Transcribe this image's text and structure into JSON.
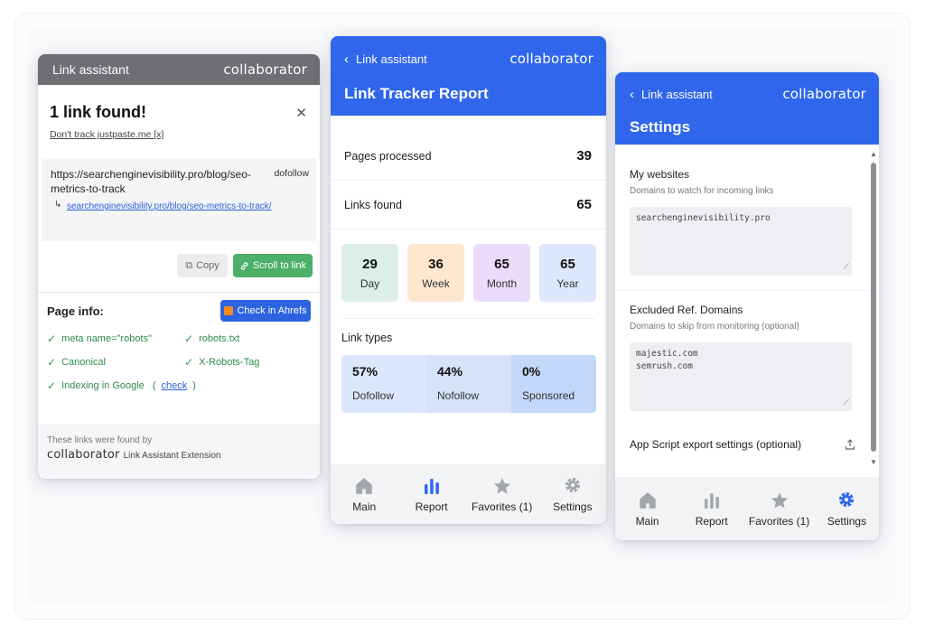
{
  "panel1": {
    "header_title": "Link assistant",
    "brand": "collaborator",
    "found_title": "1 link found!",
    "dont_track": "Don't track justpaste.me [x]",
    "link_url": "https://searchenginevisibility.pro/blog/seo-metrics-to-track",
    "link_tag": "dofollow",
    "link_sub_url": "searchenginevisibility.pro/blog/seo-metrics-to-track/",
    "copy_label": "Copy",
    "scroll_label": "Scroll to link",
    "page_info_label": "Page info:",
    "ahrefs_label": "Check in Ahrefs",
    "checks": [
      "meta name=\"robots\"",
      "robots.txt",
      "Canonical",
      "X-Robots-Tag",
      "Indexing in Google"
    ],
    "check_link": "check",
    "footer_line1": "These links were found by",
    "footer_brand": "collaborator",
    "footer_ext": "Link Assistant Extension"
  },
  "panel2": {
    "back_label": "Link assistant",
    "brand": "collaborator",
    "title": "Link Tracker Report",
    "stats": [
      {
        "label": "Pages processed",
        "value": "39"
      },
      {
        "label": "Links found",
        "value": "65"
      }
    ],
    "tiles": [
      {
        "value": "29",
        "label": "Day",
        "color": "#dcefe7"
      },
      {
        "value": "36",
        "label": "Week",
        "color": "#fde8cf"
      },
      {
        "value": "65",
        "label": "Month",
        "color": "#ecdcfb"
      },
      {
        "value": "65",
        "label": "Year",
        "color": "#dde8fd"
      }
    ],
    "link_types_title": "Link types",
    "link_types": [
      {
        "pct": "57%",
        "label": "Dofollow",
        "color": "#dde7fb"
      },
      {
        "pct": "44%",
        "label": "Nofollow",
        "color": "#d4e2fa"
      },
      {
        "pct": "0%",
        "label": "Sponsored",
        "color": "#c3d7f8"
      }
    ],
    "nav": [
      {
        "label": "Main",
        "icon": "home-icon"
      },
      {
        "label": "Report",
        "icon": "bar-chart-icon",
        "active": true
      },
      {
        "label": "Favorites (1)",
        "icon": "star-icon"
      },
      {
        "label": "Settings",
        "icon": "gear-icon"
      }
    ]
  },
  "panel3": {
    "back_label": "Link assistant",
    "brand": "collaborator",
    "title": "Settings",
    "sections": [
      {
        "title": "My websites",
        "sub": "Domains to watch for incoming links",
        "lines": [
          "searchenginevisibility.pro"
        ]
      },
      {
        "title": "Excluded Ref. Domains",
        "sub": "Domains to skip from monitoring (optional)",
        "lines": [
          "majestic.com",
          "semrush.com"
        ]
      }
    ],
    "export_label": "App Script export settings (optional)",
    "nav": [
      {
        "label": "Main",
        "icon": "home-icon"
      },
      {
        "label": "Report",
        "icon": "bar-chart-icon"
      },
      {
        "label": "Favorites (1)",
        "icon": "star-icon"
      },
      {
        "label": "Settings",
        "icon": "gear-icon",
        "active": true
      }
    ]
  },
  "colors": {
    "accent_blue": "#2f66ec",
    "header_gray": "#6d6f73",
    "success_green": "#4caf6a",
    "icon_inactive": "#a3a7ad"
  }
}
